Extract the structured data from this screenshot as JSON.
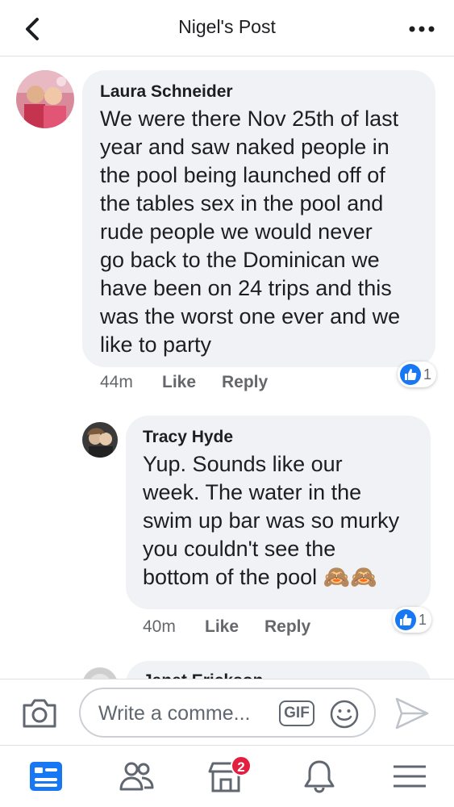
{
  "header": {
    "title": "Nigel's Post",
    "back_icon": "chevron-left-icon",
    "more_icon": "more-horizontal-icon"
  },
  "comments": [
    {
      "author": "Laura Schneider",
      "text": "We were there Nov 25th of last\nyear and saw naked people in\nthe pool being launched off of\nthe tables sex in the pool and\nrude people we would never\ngo back to the Dominican we\nhave been on 24 trips and this\nwas the worst one ever and we\nlike to party",
      "time": "44m",
      "like_label": "Like",
      "reply_label": "Reply",
      "reaction_count": "1"
    },
    {
      "author": "Tracy Hyde",
      "text": "Yup.  Sounds like our\nweek.  The water in the\nswim up bar was so murky\nyou couldn't see the\nbottom of the pool 🙈🙈",
      "time": "40m",
      "like_label": "Like",
      "reply_label": "Reply",
      "reaction_count": "1"
    },
    {
      "author": "Janet Erickson"
    }
  ],
  "composer": {
    "placeholder": "Write a comme...",
    "gif_label": "GIF",
    "camera_icon": "camera-icon",
    "emoji_icon": "smiley-icon",
    "send_icon": "send-icon"
  },
  "nav": {
    "items": [
      "news-feed-icon",
      "friends-icon",
      "marketplace-icon",
      "notifications-icon",
      "menu-icon"
    ],
    "marketplace_badge": "2"
  },
  "colors": {
    "accent": "#1877f2",
    "bubble": "#f0f2f5",
    "badge": "#e41e3f"
  }
}
